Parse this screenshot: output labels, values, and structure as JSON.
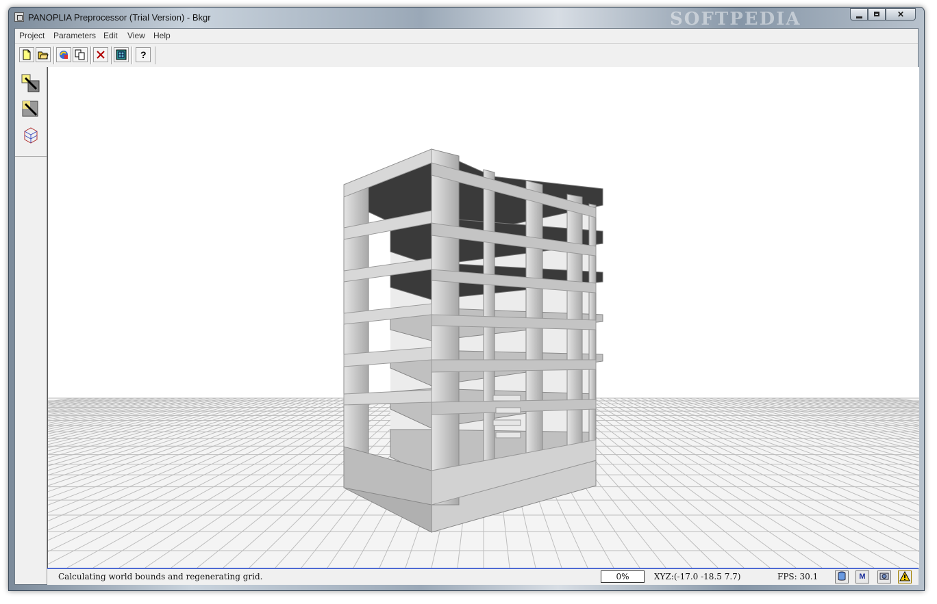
{
  "window": {
    "title": "PANOPLIA Preprocessor (Trial Version) - Bkgr",
    "watermark": "SOFTPEDIA"
  },
  "menubar": {
    "items": [
      {
        "label": "Project"
      },
      {
        "label": "Parameters"
      },
      {
        "label": "Edit"
      },
      {
        "label": "View"
      },
      {
        "label": "Help"
      }
    ]
  },
  "toolbar": {
    "buttons": [
      "new-file-icon",
      "open-folder-icon",
      "refresh-icon",
      "copy-icon",
      "delete-icon",
      "model-icon",
      "help-icon"
    ]
  },
  "sidebar": {
    "buttons": [
      "view-top-icon",
      "view-shaded-icon",
      "wireframe-cube-icon"
    ]
  },
  "statusbar": {
    "message": "Calculating world bounds and regenerating grid.",
    "progress": "0%",
    "coordinates": "XYZ:(-17.0  -18.5  7.7)",
    "fps": "FPS: 30.1",
    "icons": [
      "database-icon",
      "m-icon",
      "camera-icon",
      "warning-icon"
    ],
    "m_label": "M"
  },
  "colors": {
    "accent": "#4f6bd4",
    "concrete": "#c8c8c8",
    "slab_top": "#3a3a3a",
    "grid_line": "#b8b8b8"
  }
}
